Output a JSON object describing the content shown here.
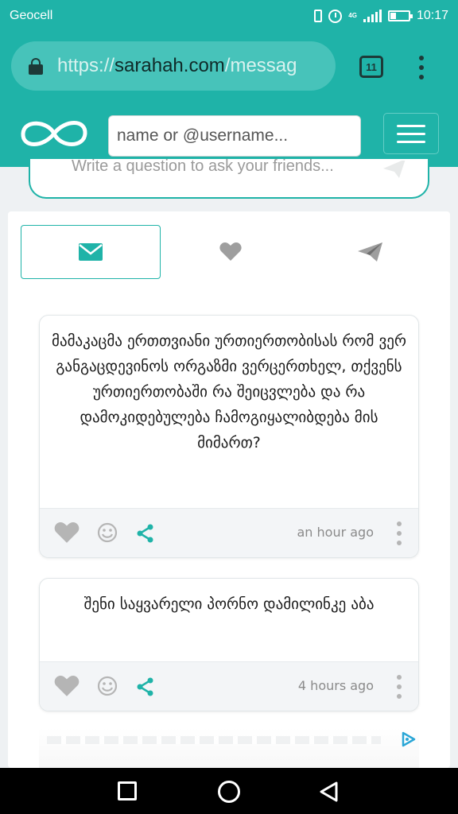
{
  "status_bar": {
    "carrier": "Geocell",
    "network": "4G",
    "time": "10:17"
  },
  "browser": {
    "url_prefix": "https://",
    "url_host": "sarahah.com",
    "url_path": "/messag",
    "tab_count": "11"
  },
  "header": {
    "search_placeholder": "name or @username..."
  },
  "ask": {
    "placeholder": "Write a question to ask your friends..."
  },
  "tabs": [
    {
      "name": "inbox",
      "icon": "envelope-icon",
      "active": true
    },
    {
      "name": "favorites",
      "icon": "heart-icon",
      "active": false
    },
    {
      "name": "sent",
      "icon": "paper-plane-icon",
      "active": false
    }
  ],
  "messages": [
    {
      "text": "მამაკაცმა ერთთვიანი ურთიერთობისას რომ ვერ განგაცდევინოს ორგაზმი ვერცერთხელ, თქვენს ურთიერთობაში რა შეიცვლება და რა დამოკიდებულება ჩამოგიყალიბდება მის მიმართ?",
      "time": "an hour ago"
    },
    {
      "text": "შენი საყვარელი პორნო დამილინკე აბა",
      "time": "4 hours ago"
    }
  ],
  "colors": {
    "brand": "#1fb3a8",
    "background": "#eef1f3",
    "icon_gray": "#b5b5b5"
  }
}
